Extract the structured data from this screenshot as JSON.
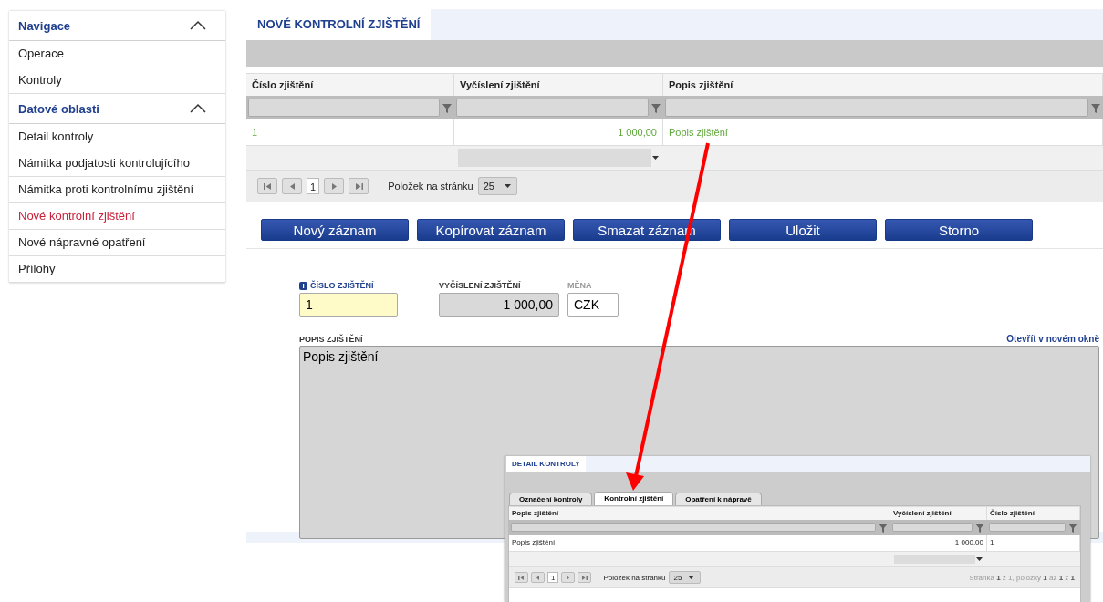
{
  "sidebar": {
    "sections": [
      {
        "title": "Navigace",
        "expanded": true,
        "items": [
          {
            "label": "Operace",
            "selected": false
          },
          {
            "label": "Kontroly",
            "selected": false
          }
        ]
      },
      {
        "title": "Datové oblasti",
        "expanded": true,
        "items": [
          {
            "label": "Detail kontroly",
            "selected": false
          },
          {
            "label": "Námitka podjatosti kontrolujícího",
            "selected": false
          },
          {
            "label": "Námitka proti kontrolnímu zjištění",
            "selected": false
          },
          {
            "label": "Nové kontrolní zjištění",
            "selected": true
          },
          {
            "label": "Nové nápravné opatření",
            "selected": false
          },
          {
            "label": "Přílohy",
            "selected": false
          }
        ]
      }
    ]
  },
  "main": {
    "tab": "NOVÉ KONTROLNÍ ZJIŠTĚNÍ",
    "table": {
      "columns": [
        {
          "label": "Číslo zjištění",
          "kind": "text"
        },
        {
          "label": "Vyčíslení zjištění",
          "kind": "number"
        },
        {
          "label": "Popis zjištění",
          "kind": "text"
        }
      ],
      "rows": [
        {
          "cells": [
            "1",
            "1 000,00",
            "Popis zjištění"
          ],
          "selected": true
        }
      ],
      "pager": {
        "page": "1",
        "page_size_label": "Položek na stránku",
        "page_size": "25"
      }
    },
    "buttons": [
      "Nový záznam",
      "Kopírovat záznam",
      "Smazat záznam",
      "Uložit",
      "Storno"
    ],
    "form": {
      "fields": [
        {
          "label": "ČÍSLO ZJIŠTĚNÍ",
          "value": "1",
          "kind": "required"
        },
        {
          "label": "VYČÍSLENÍ ZJIŠTĚNÍ",
          "value": "1 000,00",
          "kind": "readonly"
        },
        {
          "label": "MĚNA",
          "value": "CZK",
          "kind": "plain"
        }
      ],
      "description": {
        "label": "POPIS ZJIŠTĚNÍ",
        "link": "Otevřít v novém okně",
        "value": "Popis zjištění"
      }
    }
  },
  "inset": {
    "tab": "DETAIL KONTROLY",
    "subtabs": [
      {
        "label": "Označení kontroly",
        "selected": false
      },
      {
        "label": "Kontrolní zjištění",
        "selected": true
      },
      {
        "label": "Opatření k nápravě",
        "selected": false
      }
    ],
    "table": {
      "columns": [
        {
          "label": "Popis zjištění",
          "kind": "text"
        },
        {
          "label": "Vyčíslení zjištění",
          "kind": "number"
        },
        {
          "label": "Číslo zjištění",
          "kind": "text"
        }
      ],
      "rows": [
        {
          "cells": [
            "Popis zjištění",
            "1 000,00",
            "1"
          ],
          "selected": false
        }
      ],
      "pager": {
        "page": "1",
        "page_size_label": "Položek na stránku",
        "page_size": "25",
        "summary": "Stránka **1** z 1, položky **1** až **1** z **1**"
      }
    }
  }
}
